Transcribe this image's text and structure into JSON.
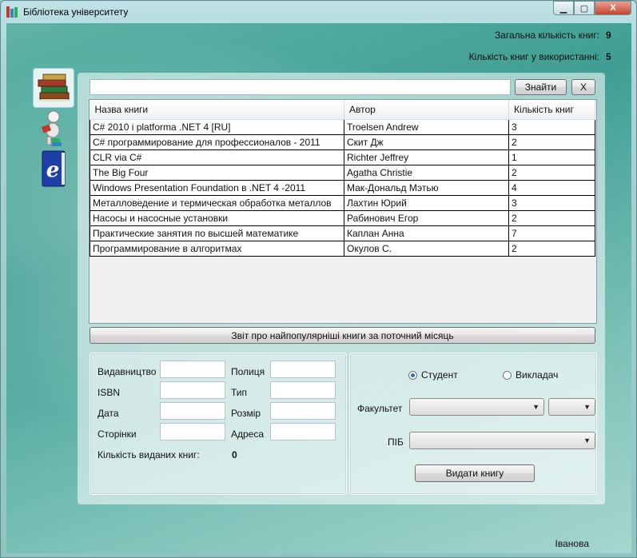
{
  "window": {
    "title": "Бібліотека університету",
    "controls": {
      "minimize": "▁",
      "maximize": "▢",
      "close": "X"
    }
  },
  "stats": {
    "total_label": "Загальна кількість книг:",
    "total_value": "9",
    "in_use_label": "Кількість книг у використанні:",
    "in_use_value": "5"
  },
  "sidebar": {
    "icons": [
      {
        "name": "books-icon",
        "active": true
      },
      {
        "name": "reader-icon",
        "active": false
      },
      {
        "name": "e-book-icon",
        "active": false
      }
    ]
  },
  "search": {
    "value": "",
    "find_label": "Знайти",
    "clear_label": "X"
  },
  "table": {
    "columns": [
      "Назва книги",
      "Автор",
      "Кількість книг"
    ],
    "rows": [
      [
        "C# 2010 і platforma .NET 4 [RU]",
        "Troelsen Andrew",
        "3"
      ],
      [
        "C# программирование для профессионалов - 2011",
        "Скит Дж",
        "2"
      ],
      [
        "CLR via C#",
        "Richter Jeffrey",
        "1"
      ],
      [
        "The Big Four",
        "Agatha Christie",
        "2"
      ],
      [
        "Windows Presentation Foundation в .NET 4 -2011",
        "Мак-Дональд Мэтью",
        "4"
      ],
      [
        "Металловедение и термическая обработка металлов",
        "Лахтин Юрий",
        "3"
      ],
      [
        "Насосы и насосные установки",
        "Рабинович Егор",
        "2"
      ],
      [
        "Практические занятия по высшей математике",
        "Каплан Анна",
        "7"
      ],
      [
        "Программирование в алгоритмах",
        "Окулов С.",
        "2"
      ]
    ]
  },
  "report_button": "Звіт про найпопулярніші книги за поточний місяць",
  "details": {
    "publisher_label": "Видавництво",
    "publisher_value": "",
    "shelf_label": "Полиця",
    "shelf_value": "",
    "isbn_label": "ISBN",
    "isbn_value": "",
    "type_label": "Тип",
    "type_value": "",
    "date_label": "Дата",
    "date_value": "",
    "size_label": "Розмір",
    "size_value": "",
    "pages_label": "Сторінки",
    "pages_value": "",
    "address_label": "Адреса",
    "address_value": "",
    "issued_label": "Кількість виданих книг:",
    "issued_value": "0"
  },
  "issue": {
    "student_label": "Студент",
    "student_selected": true,
    "teacher_label": "Викладач",
    "faculty_label": "Факультет",
    "faculty_value": "",
    "group_value": "",
    "name_label": "ПІБ",
    "name_value": "",
    "issue_button": "Видати книгу"
  },
  "status": {
    "user": "Іванова"
  }
}
